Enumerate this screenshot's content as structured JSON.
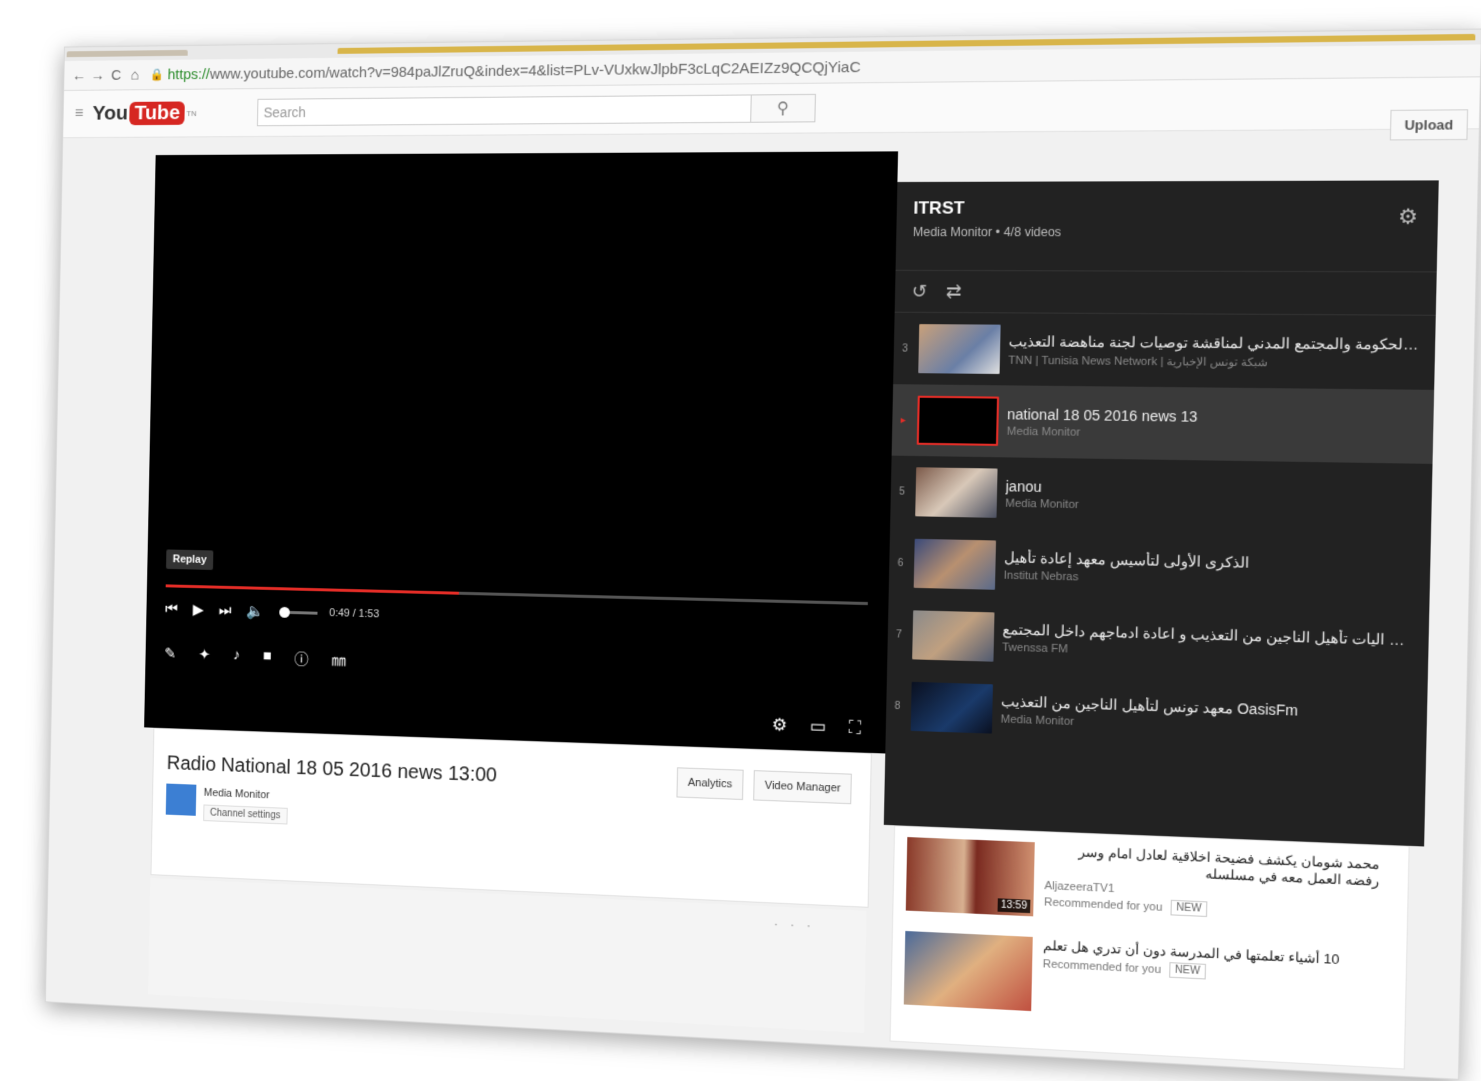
{
  "browser": {
    "url_scheme": "https://",
    "url_rest": "www.youtube.com/watch?v=984paJlZruQ&index=4&list=PLv-VUxkwJlpbF3cLqC2AEIZz9QCQjYiaC",
    "back_icon": "←",
    "forward_icon": "→",
    "reload_icon": "C",
    "home_icon": "⌂"
  },
  "header": {
    "logo_you": "You",
    "logo_tube": "Tube",
    "logo_tn": "TN",
    "search_placeholder": "Search",
    "upload_label": "Upload"
  },
  "player": {
    "replay_tooltip": "Replay",
    "time": "0:49 / 1:53",
    "progress_fraction": 0.43
  },
  "playlist": {
    "title": "ITRST",
    "subtitle": "Media Monitor • 4/8 videos",
    "items": [
      {
        "index": "3",
        "title": "ملتقى تشاوري بين الحكومة والمجتمع المدني لمناقشة توصيات لجنة مناهضة التعذيب",
        "channel": "TNN | Tunisia News Network | شبكة تونس الإخبارية"
      },
      {
        "index": "▸",
        "title": "national 18 05 2016 news 13",
        "channel": "Media Monitor"
      },
      {
        "index": "5",
        "title": "janou",
        "channel": "Media Monitor"
      },
      {
        "index": "6",
        "title": "الذكرى الأولى لتأسيس معهد إعادة تأهيل",
        "channel": "Institut Nebras"
      },
      {
        "index": "7",
        "title": "ندوة صحفية لمعهد\" نبراس\" للوقوف على اليات تأهيل الناجين من التعذيب و اعادة ادماجهم داخل المجتمع",
        "channel": "Twenssa FM"
      },
      {
        "index": "8",
        "title": "معهد تونس لتأهيل الناجين من التعذيب OasisFm",
        "channel": "Media Monitor"
      }
    ]
  },
  "video": {
    "title": "Radio National 18 05 2016 news 13:00",
    "channel": "Media Monitor",
    "channel_settings": "Channel settings",
    "analytics_label": "Analytics",
    "video_manager_label": "Video Manager"
  },
  "recommendations": [
    {
      "title": "محمد شومان يكشف فضيحة اخلاقية لعادل امام وسر رفضه العمل معه في مسلسله",
      "channel": "AljazeeraTV1",
      "meta": "Recommended for you",
      "badge": "NEW",
      "duration": "13:59"
    },
    {
      "title": "10 أشياء تعلمتها في المدرسة دون أن تدري هل تعلم",
      "channel": "",
      "meta": "Recommended for you",
      "badge": "NEW",
      "duration": ""
    }
  ]
}
